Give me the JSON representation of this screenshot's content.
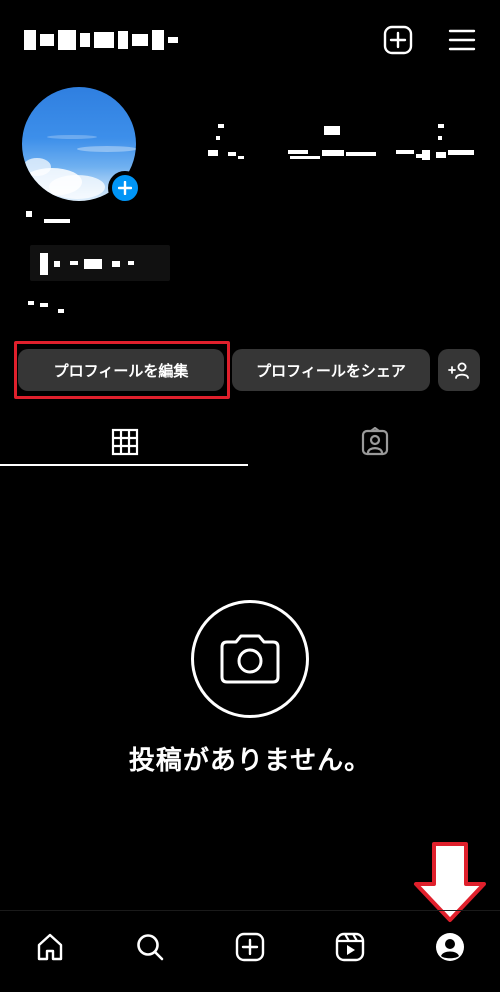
{
  "header": {
    "new_post_icon": "plus-square-icon",
    "menu_icon": "hamburger-menu-icon"
  },
  "profile": {
    "avatar_icon": "profile-photo",
    "add_story_icon": "plus-icon"
  },
  "actions": {
    "edit_profile": "プロフィールを編集",
    "share_profile": "プロフィールをシェア",
    "add_person_icon": "add-person-icon"
  },
  "tabs": [
    {
      "icon": "grid-icon",
      "selected": true
    },
    {
      "icon": "tagged-person-icon",
      "selected": false
    }
  ],
  "empty_state": {
    "icon": "camera-icon",
    "message": "投稿がありません。"
  },
  "bottom_nav": [
    {
      "icon": "home-icon"
    },
    {
      "icon": "search-icon"
    },
    {
      "icon": "create-post-icon"
    },
    {
      "icon": "reels-icon"
    },
    {
      "icon": "profile-icon"
    }
  ],
  "annotation": {
    "highlight_color": "#e0202c"
  },
  "colors": {
    "background": "#000000",
    "button": "#363636",
    "accent_blue": "#0095f6"
  }
}
